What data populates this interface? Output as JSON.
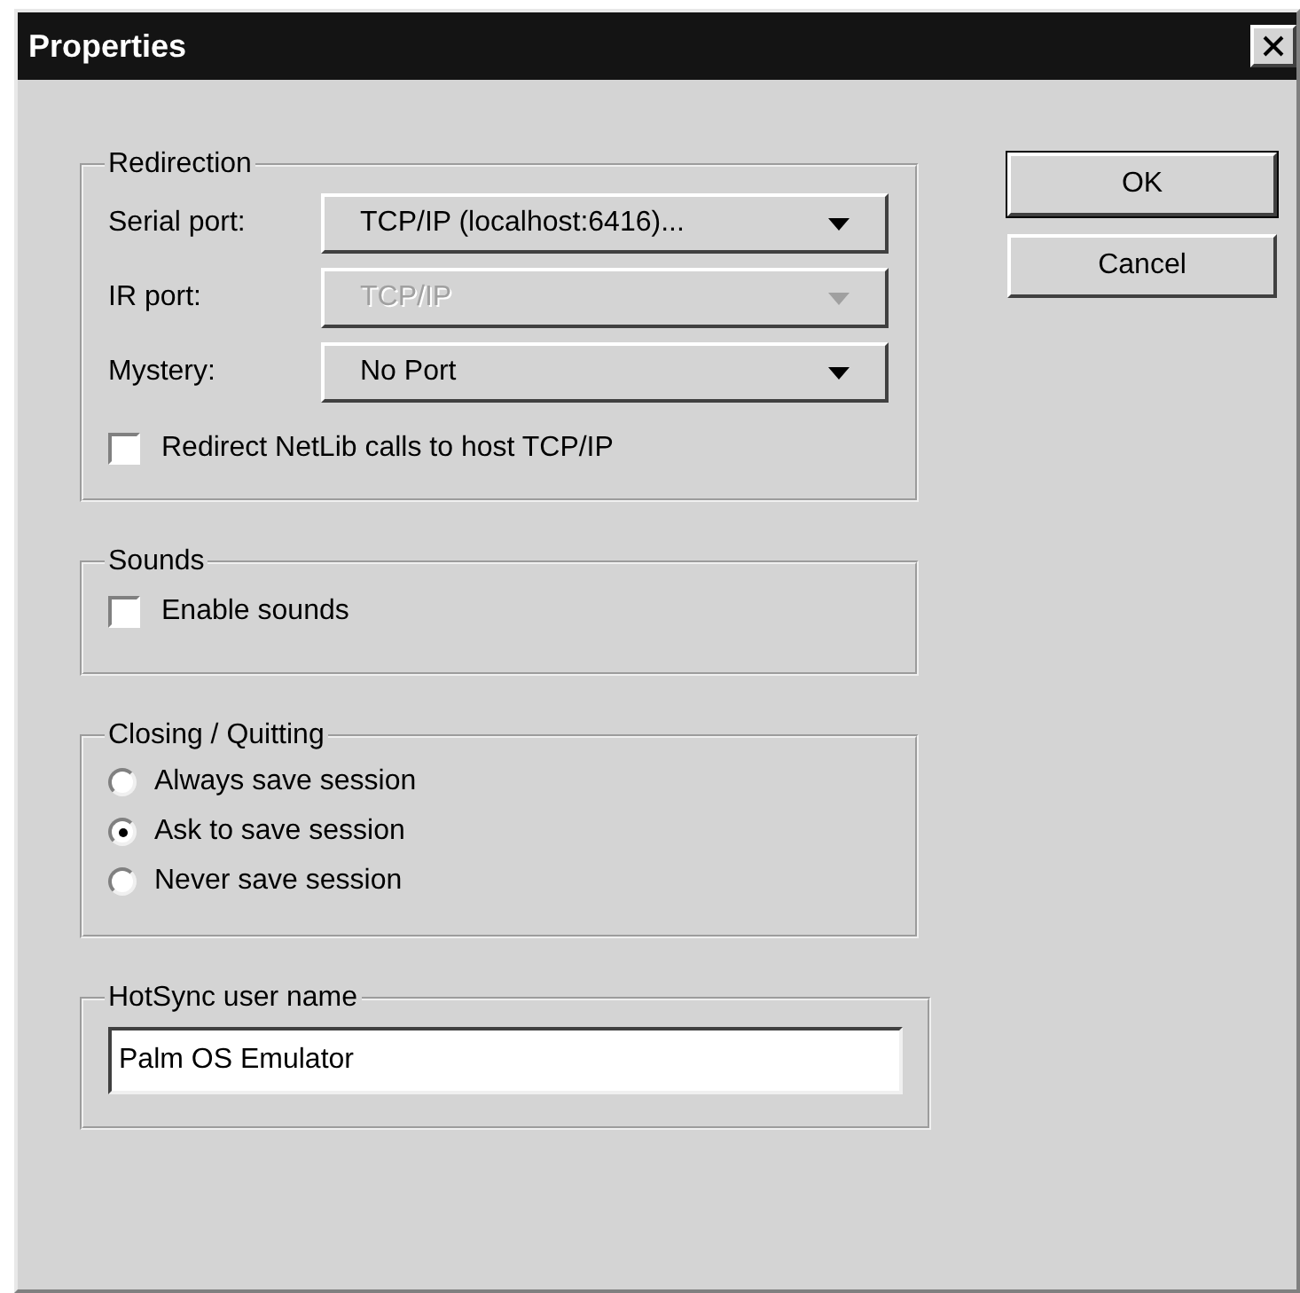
{
  "window": {
    "title": "Properties"
  },
  "redirection": {
    "title": "Redirection",
    "fields": [
      {
        "label": "Serial port:",
        "value": "TCP/IP (localhost:6416)...",
        "disabled": false
      },
      {
        "label": "IR port:",
        "value": "TCP/IP",
        "disabled": true
      },
      {
        "label": "Mystery:",
        "value": "No Port",
        "disabled": false
      }
    ],
    "checkbox": {
      "label": "Redirect NetLib calls to host TCP/IP",
      "checked": false
    }
  },
  "sounds": {
    "title": "Sounds",
    "checkbox": {
      "label": "Enable sounds",
      "checked": false
    }
  },
  "closing": {
    "title": "Closing / Quitting",
    "options": [
      {
        "label": "Always save session",
        "selected": false
      },
      {
        "label": "Ask to save session",
        "selected": true
      },
      {
        "label": "Never save session",
        "selected": false
      }
    ]
  },
  "hotsync": {
    "title": "HotSync user name",
    "value": "Palm OS Emulator"
  },
  "buttons": [
    {
      "label": "OK",
      "default": true
    },
    {
      "label": "Cancel",
      "default": false
    }
  ]
}
